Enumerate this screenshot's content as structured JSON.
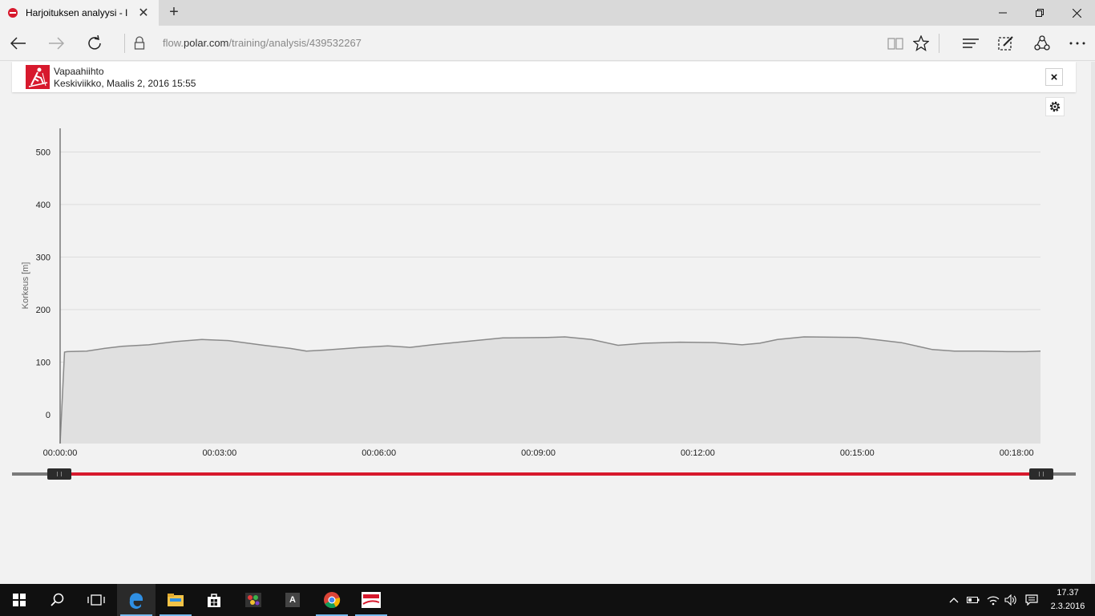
{
  "browser": {
    "tab_title": "Harjoituksen analyysi - I",
    "new_tab_symbol": "+",
    "url_prefix": "flow.",
    "url_host": "polar.com",
    "url_path": "/training/analysis/439532267"
  },
  "icons": {
    "back": "back-arrow-icon",
    "forward": "forward-arrow-icon",
    "refresh": "refresh-icon",
    "lock": "lock-icon",
    "reading_view": "book-icon",
    "favorite": "star-icon",
    "hub": "hub-icon",
    "web_note": "pen-icon",
    "share": "share-icon",
    "more": "ellipsis-icon"
  },
  "session": {
    "sport": "Vapaahiihto",
    "datetime": "Keskiviikko, Maalis 2, 2016 15:55",
    "close_symbol": "×"
  },
  "chart_data": {
    "type": "area",
    "ylabel": "Korkeus [m]",
    "yticks": [
      0,
      100,
      200,
      300,
      400,
      500
    ],
    "ylim": [
      -55,
      545
    ],
    "xticks": [
      "00:00:00",
      "00:03:00",
      "00:06:00",
      "00:09:00",
      "00:12:00",
      "00:15:00",
      "00:18:00"
    ],
    "xlim_seconds": [
      0,
      1107
    ],
    "grid": true,
    "series": [
      {
        "x_seconds": [
          0,
          5,
          8,
          30,
          50,
          70,
          100,
          130,
          160,
          190,
          230,
          260,
          278,
          300,
          340,
          370,
          395,
          420,
          450,
          500,
          550,
          570,
          600,
          630,
          660,
          700,
          740,
          770,
          790,
          810,
          840,
          900,
          950,
          985,
          1010,
          1040,
          1070,
          1090,
          1107
        ],
        "values": [
          -55,
          119,
          120,
          121,
          126,
          130,
          133,
          139,
          143,
          141,
          132,
          126,
          121,
          123,
          128,
          131,
          128,
          133,
          138,
          146,
          147,
          148,
          143,
          132,
          136,
          138,
          137,
          133,
          136,
          143,
          148,
          147,
          137,
          124,
          121,
          121,
          120,
          120,
          121
        ]
      }
    ],
    "colors": {
      "line": "#8a8a8a",
      "fill": "#e0e0e0",
      "grid": "#dcdcdc",
      "axis": "#777777"
    }
  },
  "range_slider": {
    "start": "00:00:00",
    "end": "00:18:27",
    "accent": "#d7192d"
  },
  "taskbar": {
    "apps": [
      "start-icon",
      "search-icon",
      "task-view-icon",
      "edge-icon",
      "file-explorer-icon",
      "store-icon",
      "paint-icon",
      "font-app-icon",
      "chrome-icon",
      "polar-flowsync-icon"
    ],
    "font_app_letter": "A",
    "time": "17.37",
    "date": "2.3.2016"
  }
}
